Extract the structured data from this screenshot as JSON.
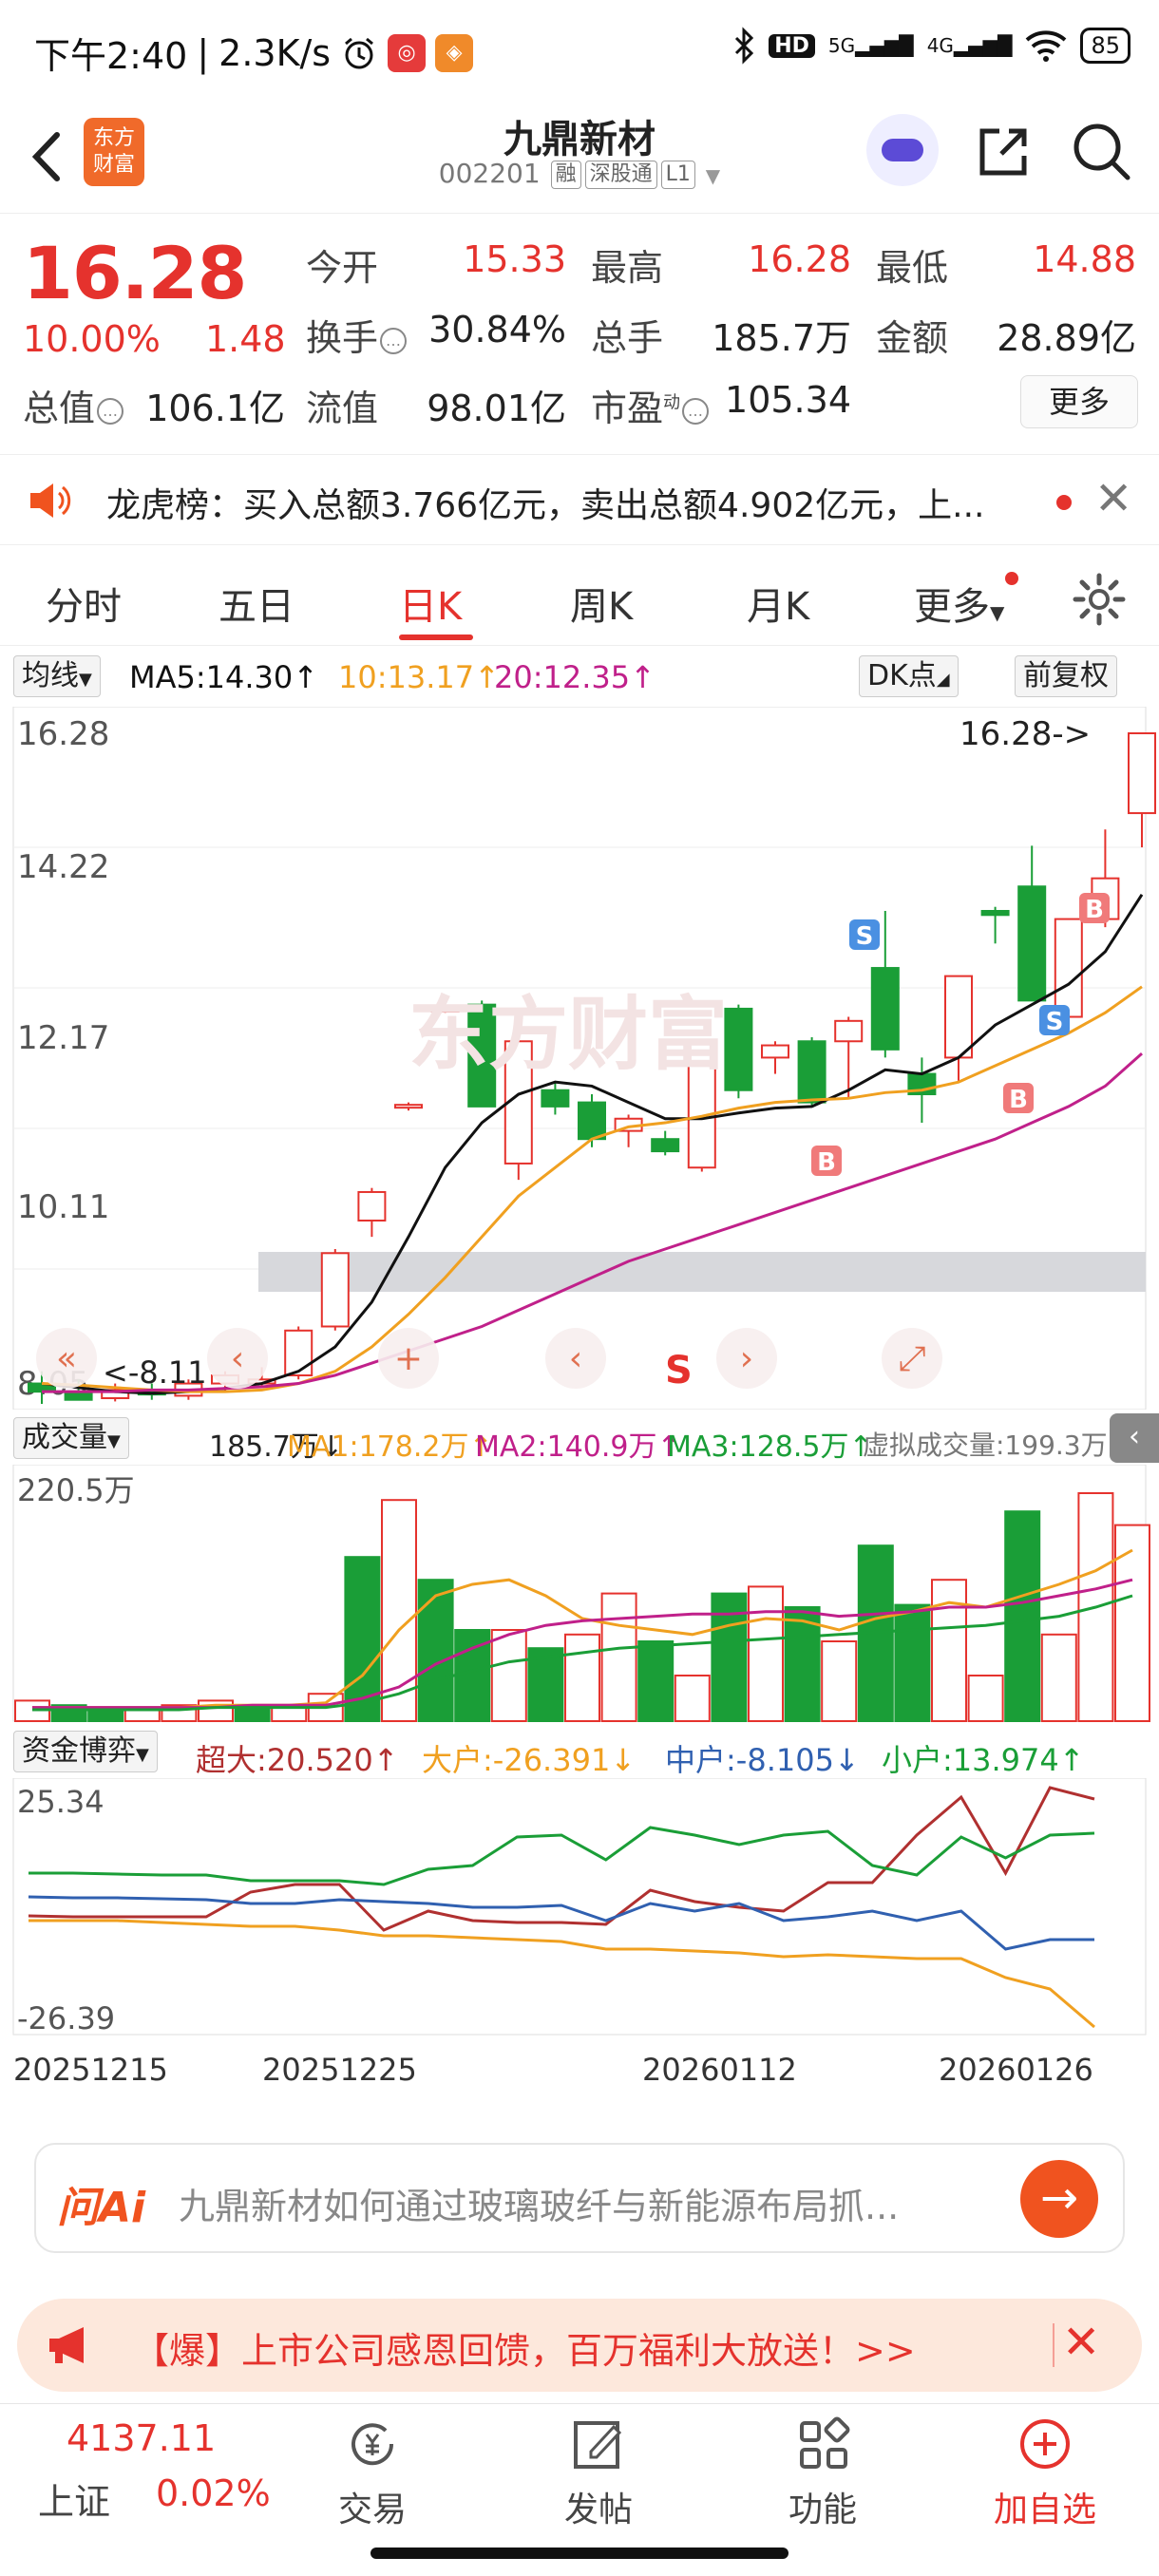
{
  "status_bar": {
    "time": "下午2:40",
    "net_speed": "2.3K/s",
    "hd": "HD",
    "sig5g": "5G",
    "sig4g": "4G",
    "battery": "85"
  },
  "nav": {
    "logo_text_1": "东方",
    "logo_text_2": "财富",
    "title": "九鼎新材",
    "code": "002201",
    "tags": [
      "融",
      "深股通",
      "L1"
    ]
  },
  "quote": {
    "price": "16.28",
    "change_pct": "10.00%",
    "change_amt": "1.48",
    "labels": {
      "open": "今开",
      "high": "最高",
      "low": "最低",
      "turnover": "换手",
      "volume": "总手",
      "amount": "金额",
      "mkt_cap": "总值",
      "float_cap": "流值",
      "pe": "市盈",
      "pe_sup": "动"
    },
    "values": {
      "open": "15.33",
      "high": "16.28",
      "low": "14.88",
      "turnover": "30.84%",
      "volume": "185.7万",
      "amount": "28.89亿",
      "mkt_cap": "106.1亿",
      "float_cap": "98.01亿",
      "pe": "105.34"
    },
    "more": "更多"
  },
  "dragon_tiger": {
    "text": "龙虎榜：买入总额3.766亿元，卖出总额4.902亿元，上..."
  },
  "tabs": {
    "items": [
      "分时",
      "五日",
      "日K",
      "周K",
      "月K",
      "更多"
    ],
    "active": "日K"
  },
  "ma_bar": {
    "selector": "均线",
    "ma5": "MA5:14.30",
    "ma10": "10:13.17",
    "ma20": "20:12.35",
    "dk": "DK点",
    "fq": "前复权"
  },
  "kline": {
    "y_labels": [
      "16.28",
      "14.22",
      "12.17",
      "10.11",
      "8.05"
    ],
    "latest_marker": "16.28->",
    "low_marker": "<-8.11",
    "watermark": "东方财富",
    "signals": [
      "S",
      "B"
    ],
    "s_label": "S"
  },
  "volume_bar": {
    "selector": "成交量",
    "vol": "185.7万",
    "ma1": "MA1:178.2万",
    "ma2": "MA2:140.9万",
    "ma3": "MA3:128.5万",
    "virtual": "虚拟成交量:199.3万",
    "top_label": "220.5万"
  },
  "fund_bar": {
    "selector": "资金博弈",
    "super": "超大:20.520",
    "large": "大户:-26.391",
    "medium": "中户:-8.105",
    "small": "小户:13.974",
    "top_label": "25.34",
    "bottom_label": "-26.39"
  },
  "dates": [
    "20251215",
    "20251225",
    "20260112",
    "20260126"
  ],
  "ai": {
    "logo": "问Ai",
    "prompt": "九鼎新材如何通过玻璃玻纤与新能源布局抓..."
  },
  "promo": {
    "text": "【爆】上市公司感恩回馈，百万福利大放送！>>"
  },
  "bottom_bar": {
    "index_value": "4137.11",
    "index_name": "上证",
    "index_pct": "0.02%",
    "items": [
      "交易",
      "发帖",
      "功能",
      "加自选"
    ]
  },
  "colors": {
    "up": "#e5322d",
    "down": "#1a9e37",
    "ma5": "#111111",
    "ma10": "#f0a020",
    "ma20": "#c0208a",
    "super": "#b03030",
    "large": "#f0a020",
    "medium": "#3060b0",
    "small": "#1a9e37"
  }
}
